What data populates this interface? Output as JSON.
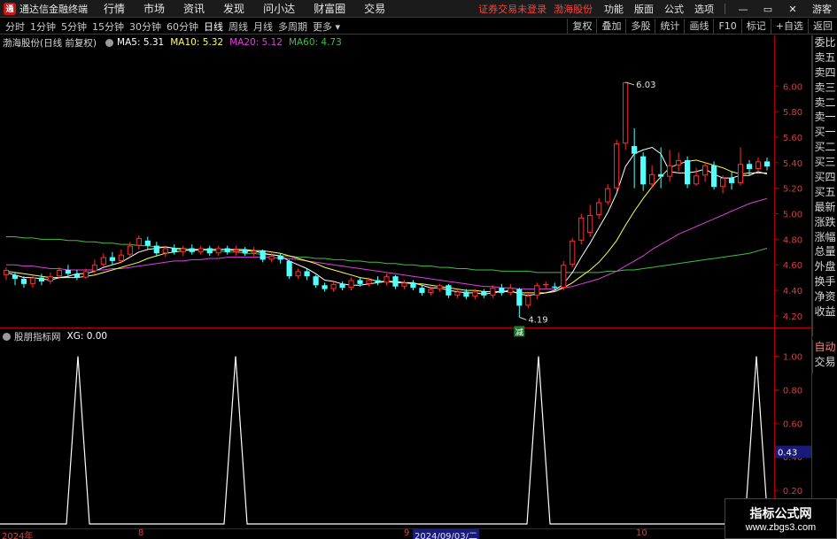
{
  "menubar": {
    "title": "通达信金融终端",
    "items": [
      "行情",
      "市场",
      "资讯",
      "发现",
      "问小达",
      "财富圈",
      "交易"
    ],
    "alert": "证券交易未登录",
    "stock": "渤海股份",
    "right_items": [
      "功能",
      "版面",
      "公式",
      "选项"
    ],
    "guest": "游客",
    "window_buttons": [
      "minimize-icon",
      "restore-icon",
      "close-icon"
    ]
  },
  "periodbar": {
    "periods": [
      "分时",
      "1分钟",
      "5分钟",
      "15分钟",
      "30分钟",
      "60分钟",
      "日线",
      "周线",
      "月线",
      "多周期",
      "更多"
    ],
    "active": "日线",
    "tools": [
      "复权",
      "叠加",
      "多股",
      "统计",
      "画线",
      "F10",
      "标记",
      "+自选",
      "返回"
    ]
  },
  "legend_main": {
    "name": "渤海股份(日线 前复权)",
    "ma5": "MA5: 5.31",
    "ma10": "MA10: 5.32",
    "ma20": "MA20: 5.12",
    "ma60": "MA60: 4.73"
  },
  "legend_sub": {
    "name": "股朋指标网",
    "xg": "XG: 0.00"
  },
  "colors": {
    "up": "#ff3030",
    "down": "#54ffff",
    "ma5": "#ffffff",
    "ma10": "#ffff50",
    "ma20": "#e040e0",
    "ma60": "#40c040",
    "axis_red": "#b00000"
  },
  "side_panel": [
    "委比",
    "卖五",
    "卖四",
    "卖三",
    "卖二",
    "卖一",
    "买一",
    "买二",
    "买三",
    "买四",
    "买五",
    "最新",
    "涨跌",
    "涨幅",
    "总量",
    "外盘",
    "换手",
    "净资",
    "收益"
  ],
  "side_panel2": [
    "自动",
    "交易"
  ],
  "annotations": {
    "high": "6.03",
    "low": "4.19",
    "low_badge": "减",
    "sub_value": "0.43"
  },
  "time_axis": [
    "2024年",
    "8",
    "9",
    "2024/09/03/二",
    "10"
  ],
  "watermark": {
    "title": "指标公式网",
    "url": "www.zbgs3.com"
  },
  "chart_data": {
    "type": "candlestick",
    "price_axis": {
      "ticks": [
        "6.00",
        "5.80",
        "5.60",
        "5.40",
        "5.20",
        "5.00",
        "4.80",
        "4.60",
        "4.40",
        "4.20"
      ],
      "ylim": [
        4.13,
        6.3
      ]
    },
    "sub_axis": {
      "ticks": [
        "1.00",
        "0.80",
        "0.60",
        "0.40",
        "0.20"
      ],
      "ylim": [
        0,
        1.05
      ]
    },
    "candles": [
      [
        4.52,
        4.56,
        4.58,
        4.48
      ],
      [
        4.52,
        4.49,
        4.54,
        4.44
      ],
      [
        4.49,
        4.45,
        4.51,
        4.42
      ],
      [
        4.45,
        4.5,
        4.52,
        4.42
      ],
      [
        4.5,
        4.47,
        4.53,
        4.44
      ],
      [
        4.47,
        4.51,
        4.54,
        4.45
      ],
      [
        4.51,
        4.56,
        4.58,
        4.49
      ],
      [
        4.56,
        4.53,
        4.6,
        4.5
      ],
      [
        4.53,
        4.5,
        4.56,
        4.48
      ],
      [
        4.5,
        4.55,
        4.57,
        4.49
      ],
      [
        4.55,
        4.6,
        4.64,
        4.53
      ],
      [
        4.6,
        4.66,
        4.69,
        4.58
      ],
      [
        4.66,
        4.63,
        4.7,
        4.6
      ],
      [
        4.63,
        4.68,
        4.72,
        4.61
      ],
      [
        4.68,
        4.75,
        4.78,
        4.66
      ],
      [
        4.75,
        4.81,
        4.83,
        4.72
      ],
      [
        4.79,
        4.75,
        4.82,
        4.72
      ],
      [
        4.75,
        4.69,
        4.78,
        4.67
      ],
      [
        4.69,
        4.73,
        4.75,
        4.66
      ],
      [
        4.73,
        4.7,
        4.76,
        4.68
      ],
      [
        4.7,
        4.73,
        4.75,
        4.67
      ],
      [
        4.73,
        4.7,
        4.76,
        4.68
      ],
      [
        4.7,
        4.73,
        4.75,
        4.68
      ],
      [
        4.73,
        4.69,
        4.75,
        4.67
      ],
      [
        4.69,
        4.73,
        4.75,
        4.67
      ],
      [
        4.73,
        4.7,
        4.75,
        4.68
      ],
      [
        4.7,
        4.72,
        4.75,
        4.67
      ],
      [
        4.72,
        4.69,
        4.74,
        4.67
      ],
      [
        4.69,
        4.71,
        4.74,
        4.67
      ],
      [
        4.71,
        4.64,
        4.72,
        4.62
      ],
      [
        4.64,
        4.67,
        4.69,
        4.62
      ],
      [
        4.67,
        4.64,
        4.69,
        4.61
      ],
      [
        4.63,
        4.51,
        4.64,
        4.49
      ],
      [
        4.51,
        4.55,
        4.57,
        4.49
      ],
      [
        4.55,
        4.51,
        4.57,
        4.48
      ],
      [
        4.51,
        4.44,
        4.52,
        4.42
      ],
      [
        4.44,
        4.41,
        4.46,
        4.39
      ],
      [
        4.41,
        4.45,
        4.47,
        4.39
      ],
      [
        4.45,
        4.42,
        4.47,
        4.4
      ],
      [
        4.42,
        4.48,
        4.5,
        4.4
      ],
      [
        4.48,
        4.45,
        4.5,
        4.43
      ],
      [
        4.45,
        4.48,
        4.5,
        4.43
      ],
      [
        4.48,
        4.46,
        4.51,
        4.44
      ],
      [
        4.46,
        4.51,
        4.53,
        4.44
      ],
      [
        4.51,
        4.43,
        4.52,
        4.41
      ],
      [
        4.43,
        4.46,
        4.48,
        4.41
      ],
      [
        4.46,
        4.42,
        4.48,
        4.4
      ],
      [
        4.42,
        4.38,
        4.44,
        4.36
      ],
      [
        4.38,
        4.41,
        4.43,
        4.36
      ],
      [
        4.41,
        4.44,
        4.45,
        4.39
      ],
      [
        4.44,
        4.36,
        4.45,
        4.34
      ],
      [
        4.36,
        4.39,
        4.41,
        4.34
      ],
      [
        4.39,
        4.35,
        4.41,
        4.33
      ],
      [
        4.35,
        4.39,
        4.41,
        4.33
      ],
      [
        4.39,
        4.36,
        4.41,
        4.34
      ],
      [
        4.36,
        4.42,
        4.44,
        4.34
      ],
      [
        4.42,
        4.38,
        4.45,
        4.36
      ],
      [
        4.38,
        4.42,
        4.45,
        4.36
      ],
      [
        4.41,
        4.28,
        4.42,
        4.19
      ],
      [
        4.28,
        4.36,
        4.38,
        4.26
      ],
      [
        4.36,
        4.44,
        4.46,
        4.33
      ],
      [
        4.44,
        4.45,
        4.47,
        4.41
      ],
      [
        4.43,
        4.42,
        4.46,
        4.4
      ],
      [
        4.42,
        4.6,
        4.63,
        4.4
      ],
      [
        4.6,
        4.79,
        4.81,
        4.58
      ],
      [
        4.79,
        4.97,
        5.0,
        4.76
      ],
      [
        4.85,
        4.99,
        5.07,
        4.82
      ],
      [
        4.99,
        5.09,
        5.12,
        4.96
      ],
      [
        5.09,
        5.2,
        5.23,
        5.07
      ],
      [
        5.2,
        5.55,
        5.58,
        5.18
      ],
      [
        5.55,
        6.03,
        6.03,
        5.5
      ],
      [
        5.53,
        5.47,
        5.67,
        5.2
      ],
      [
        5.45,
        5.23,
        5.48,
        5.18
      ],
      [
        5.23,
        5.31,
        5.38,
        5.2
      ],
      [
        5.31,
        5.29,
        5.52,
        5.2
      ],
      [
        5.29,
        5.38,
        5.5,
        5.25
      ],
      [
        5.38,
        5.42,
        5.48,
        5.33
      ],
      [
        5.42,
        5.23,
        5.45,
        5.2
      ],
      [
        5.23,
        5.3,
        5.36,
        5.22
      ],
      [
        5.3,
        5.38,
        5.4,
        5.25
      ],
      [
        5.38,
        5.21,
        5.41,
        5.19
      ],
      [
        5.21,
        5.28,
        5.3,
        5.16
      ],
      [
        5.28,
        5.24,
        5.33,
        5.19
      ],
      [
        5.24,
        5.39,
        5.52,
        5.22
      ],
      [
        5.39,
        5.35,
        5.42,
        5.3
      ],
      [
        5.35,
        5.41,
        5.44,
        5.33
      ],
      [
        5.41,
        5.37,
        5.44,
        5.34
      ]
    ],
    "ma5": [
      4.54,
      4.52,
      4.5,
      4.5,
      4.49,
      4.48,
      4.5,
      4.51,
      4.53,
      4.53,
      4.55,
      4.58,
      4.6,
      4.62,
      4.66,
      4.7,
      4.72,
      4.73,
      4.74,
      4.73,
      4.72,
      4.71,
      4.72,
      4.72,
      4.72,
      4.72,
      4.71,
      4.71,
      4.71,
      4.69,
      4.68,
      4.67,
      4.63,
      4.6,
      4.57,
      4.53,
      4.48,
      4.47,
      4.45,
      4.44,
      4.44,
      4.45,
      4.46,
      4.47,
      4.47,
      4.46,
      4.46,
      4.44,
      4.42,
      4.42,
      4.4,
      4.39,
      4.38,
      4.38,
      4.37,
      4.38,
      4.39,
      4.4,
      4.37,
      4.36,
      4.37,
      4.38,
      4.4,
      4.45,
      4.54,
      4.66,
      4.77,
      4.89,
      5.01,
      5.16,
      5.37,
      5.47,
      5.5,
      5.52,
      5.47,
      5.33,
      5.32,
      5.32,
      5.33,
      5.35,
      5.31,
      5.28,
      5.28,
      5.3,
      5.3,
      5.33,
      5.31
    ],
    "ma10": [
      4.55,
      4.54,
      4.53,
      4.52,
      4.51,
      4.5,
      4.5,
      4.5,
      4.5,
      4.51,
      4.52,
      4.54,
      4.56,
      4.58,
      4.6,
      4.62,
      4.65,
      4.67,
      4.69,
      4.7,
      4.71,
      4.72,
      4.72,
      4.72,
      4.72,
      4.72,
      4.72,
      4.72,
      4.71,
      4.71,
      4.7,
      4.69,
      4.67,
      4.65,
      4.63,
      4.61,
      4.58,
      4.56,
      4.54,
      4.52,
      4.5,
      4.49,
      4.47,
      4.47,
      4.46,
      4.46,
      4.45,
      4.45,
      4.44,
      4.43,
      4.42,
      4.41,
      4.4,
      4.4,
      4.39,
      4.39,
      4.39,
      4.39,
      4.38,
      4.38,
      4.38,
      4.38,
      4.39,
      4.42,
      4.46,
      4.51,
      4.56,
      4.62,
      4.7,
      4.79,
      4.91,
      5.02,
      5.12,
      5.21,
      5.29,
      5.36,
      5.39,
      5.41,
      5.42,
      5.4,
      5.38,
      5.36,
      5.33,
      5.31,
      5.32,
      5.32,
      5.32
    ],
    "ma20": [
      4.6,
      4.6,
      4.59,
      4.59,
      4.58,
      4.57,
      4.57,
      4.56,
      4.56,
      4.56,
      4.56,
      4.56,
      4.57,
      4.57,
      4.58,
      4.59,
      4.6,
      4.61,
      4.62,
      4.63,
      4.63,
      4.64,
      4.64,
      4.65,
      4.65,
      4.66,
      4.66,
      4.66,
      4.66,
      4.66,
      4.66,
      4.65,
      4.65,
      4.64,
      4.63,
      4.62,
      4.61,
      4.6,
      4.59,
      4.58,
      4.57,
      4.56,
      4.55,
      4.54,
      4.53,
      4.52,
      4.51,
      4.5,
      4.49,
      4.48,
      4.47,
      4.46,
      4.45,
      4.44,
      4.43,
      4.43,
      4.42,
      4.42,
      4.41,
      4.41,
      4.41,
      4.41,
      4.41,
      4.42,
      4.43,
      4.45,
      4.47,
      4.49,
      4.52,
      4.55,
      4.59,
      4.63,
      4.67,
      4.72,
      4.76,
      4.8,
      4.84,
      4.87,
      4.9,
      4.93,
      4.96,
      4.99,
      5.02,
      5.05,
      5.08,
      5.1,
      5.12
    ],
    "ma60": [
      4.82,
      4.82,
      4.81,
      4.81,
      4.8,
      4.8,
      4.8,
      4.79,
      4.79,
      4.78,
      4.78,
      4.77,
      4.77,
      4.76,
      4.76,
      4.75,
      4.75,
      4.74,
      4.74,
      4.73,
      4.73,
      4.72,
      4.72,
      4.71,
      4.71,
      4.7,
      4.7,
      4.69,
      4.69,
      4.68,
      4.68,
      4.67,
      4.67,
      4.66,
      4.66,
      4.65,
      4.65,
      4.64,
      4.64,
      4.63,
      4.63,
      4.62,
      4.62,
      4.61,
      4.61,
      4.6,
      4.6,
      4.59,
      4.59,
      4.58,
      4.58,
      4.57,
      4.57,
      4.56,
      4.56,
      4.56,
      4.55,
      4.55,
      4.55,
      4.55,
      4.54,
      4.54,
      4.54,
      4.54,
      4.54,
      4.54,
      4.54,
      4.54,
      4.55,
      4.55,
      4.56,
      4.56,
      4.57,
      4.58,
      4.59,
      4.6,
      4.61,
      4.62,
      4.63,
      4.64,
      4.65,
      4.66,
      4.67,
      4.68,
      4.69,
      4.71,
      4.73
    ],
    "xg_spikes": [
      6,
      19,
      45,
      63
    ],
    "xg_values_last": 0.0
  }
}
